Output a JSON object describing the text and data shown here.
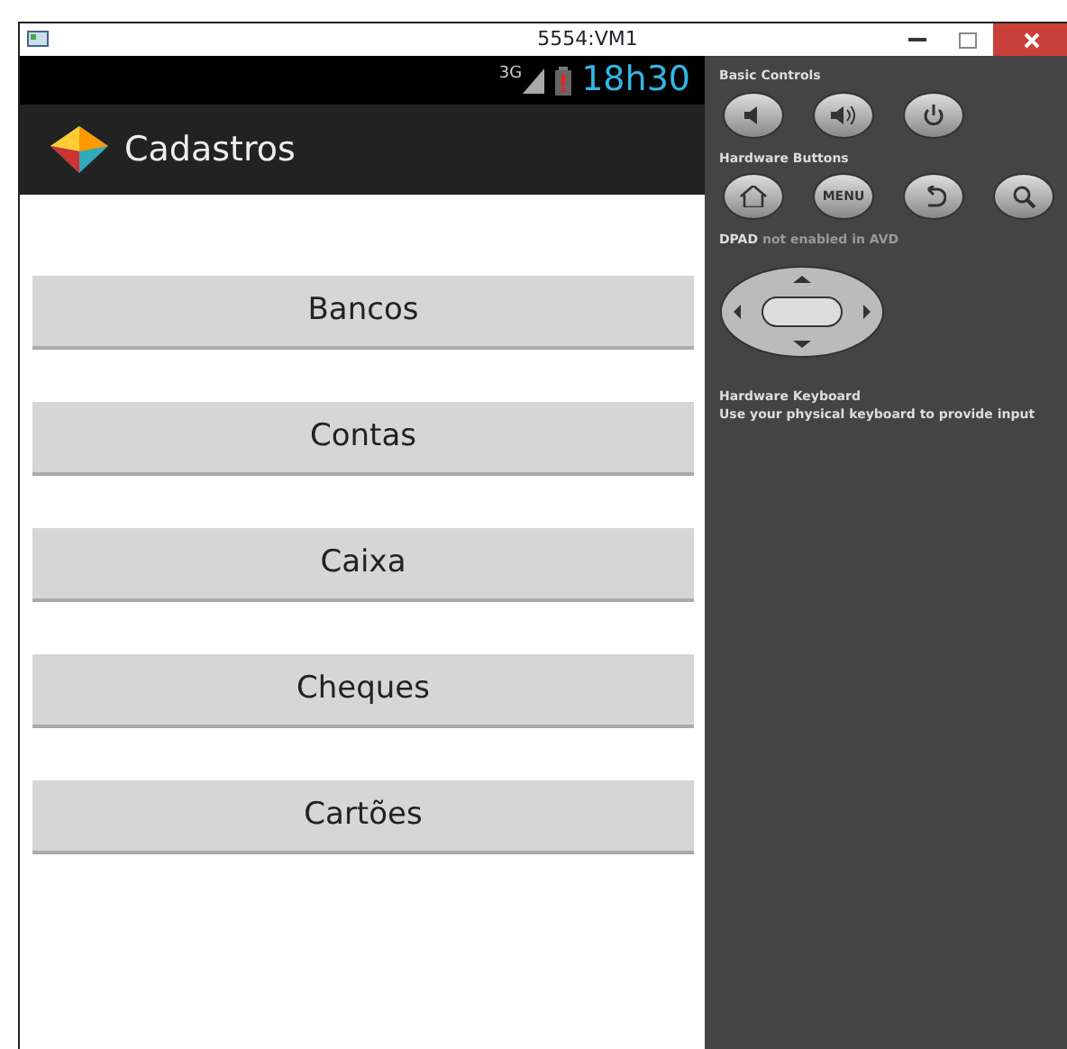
{
  "window": {
    "title": "5554:VM1"
  },
  "status_bar": {
    "network": "3G",
    "time": "18h30"
  },
  "action_bar": {
    "title": "Cadastros"
  },
  "buttons": [
    {
      "label": "Bancos"
    },
    {
      "label": "Contas"
    },
    {
      "label": "Caixa"
    },
    {
      "label": "Cheques"
    },
    {
      "label": "Cartões"
    }
  ],
  "controls": {
    "basic_title": "Basic Controls",
    "hardware_title": "Hardware Buttons",
    "menu_label": "MENU",
    "dpad_note": "**DPAD** not enabled in AVD",
    "keyboard_title": "Hardware Keyboard",
    "keyboard_note": "Use your physical keyboard to provide input"
  }
}
